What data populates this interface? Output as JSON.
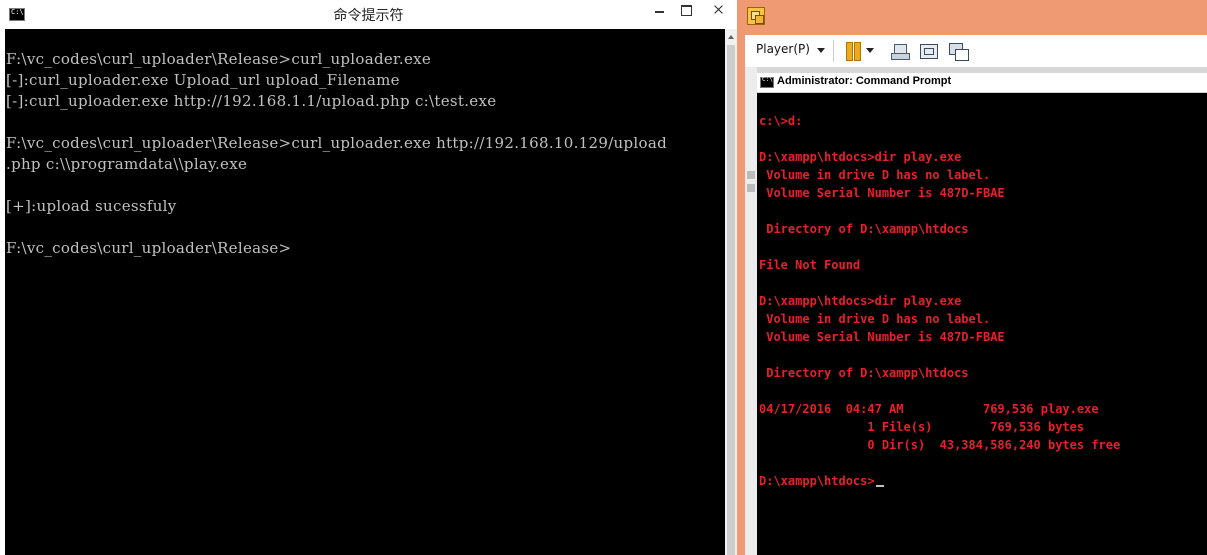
{
  "left_window": {
    "title": "命令提示符",
    "lines": [
      "F:\\vc_codes\\curl_uploader\\Release>curl_uploader.exe",
      "[-]:curl_uploader.exe Upload_url upload_Filename",
      "[-]:curl_uploader.exe http://192.168.1.1/upload.php c:\\test.exe",
      "",
      "F:\\vc_codes\\curl_uploader\\Release>curl_uploader.exe http://192.168.10.129/upload",
      ".php c:\\\\programdata\\\\play.exe",
      "",
      "[+]:upload sucessfuly",
      "",
      "F:\\vc_codes\\curl_uploader\\Release>"
    ]
  },
  "right_window": {
    "toolbar": {
      "player_label": "Player(P)"
    },
    "guest": {
      "title": "Administrator: Command Prompt",
      "lines": [
        "",
        "c:\\>d:",
        "",
        "D:\\xampp\\htdocs>dir play.exe",
        " Volume in drive D has no label.",
        " Volume Serial Number is 487D-FBAE",
        "",
        " Directory of D:\\xampp\\htdocs",
        "",
        "File Not Found",
        "",
        "D:\\xampp\\htdocs>dir play.exe",
        " Volume in drive D has no label.",
        " Volume Serial Number is 487D-FBAE",
        "",
        " Directory of D:\\xampp\\htdocs",
        "",
        "04/17/2016  04:47 AM           769,536 play.exe",
        "               1 File(s)        769,536 bytes",
        "               0 Dir(s)  43,384,586,240 bytes free",
        "",
        "D:\\xampp\\htdocs>"
      ]
    }
  },
  "colors": {
    "vm_frame": "#ef9a72",
    "guest_text": "#e8202a",
    "host_text": "#c0c0c0"
  },
  "icons": {
    "left_app": "cmd-icon",
    "right_app": "vmware-player-icon",
    "pause": "pause-icon",
    "send_keys": "send-ctrl-alt-del-icon",
    "fullscreen": "fullscreen-icon",
    "unity": "unity-icon"
  }
}
